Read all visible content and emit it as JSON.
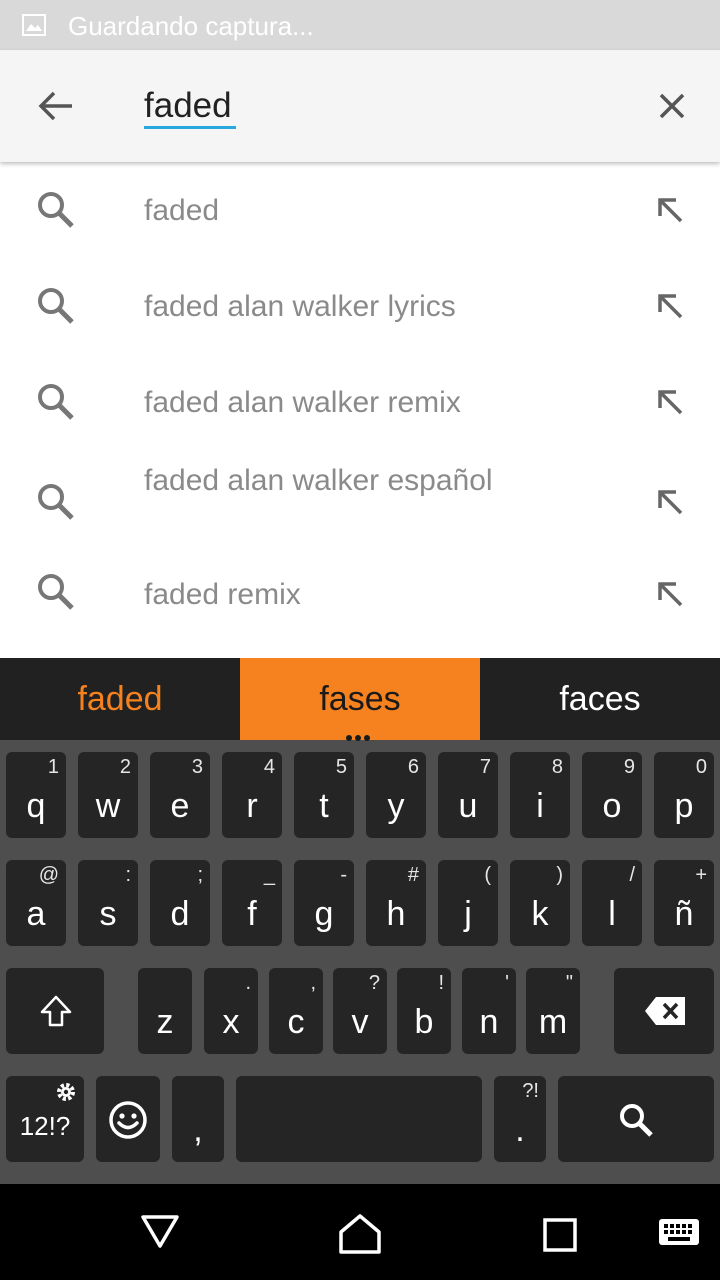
{
  "status_bar": {
    "icon": "image-icon",
    "text": "Guardando captura..."
  },
  "search": {
    "query": "faded",
    "back_icon": "arrow-left-icon",
    "clear_icon": "close-icon"
  },
  "suggestions": [
    {
      "text": "faded",
      "icon": "search-icon",
      "action_icon": "arrow-up-left-icon"
    },
    {
      "text": "faded alan walker lyrics",
      "icon": "search-icon",
      "action_icon": "arrow-up-left-icon"
    },
    {
      "text": "faded alan walker remix",
      "icon": "search-icon",
      "action_icon": "arrow-up-left-icon"
    },
    {
      "text": "faded alan walker español",
      "icon": "search-icon",
      "action_icon": "arrow-up-left-icon"
    },
    {
      "text": "faded remix",
      "icon": "search-icon",
      "action_icon": "arrow-up-left-icon"
    }
  ],
  "keyboard": {
    "accent_color": "#f5821f",
    "candidates": [
      "faded",
      "fases",
      "faces"
    ],
    "selected_candidate": "fases",
    "row1": [
      {
        "main": "q",
        "hint": "1"
      },
      {
        "main": "w",
        "hint": "2"
      },
      {
        "main": "e",
        "hint": "3"
      },
      {
        "main": "r",
        "hint": "4"
      },
      {
        "main": "t",
        "hint": "5"
      },
      {
        "main": "y",
        "hint": "6"
      },
      {
        "main": "u",
        "hint": "7"
      },
      {
        "main": "i",
        "hint": "8"
      },
      {
        "main": "o",
        "hint": "9"
      },
      {
        "main": "p",
        "hint": "0"
      }
    ],
    "row2": [
      {
        "main": "a",
        "hint": "@"
      },
      {
        "main": "s",
        "hint": ":"
      },
      {
        "main": "d",
        "hint": ";"
      },
      {
        "main": "f",
        "hint": "_"
      },
      {
        "main": "g",
        "hint": "-"
      },
      {
        "main": "h",
        "hint": "#"
      },
      {
        "main": "j",
        "hint": "("
      },
      {
        "main": "k",
        "hint": ")"
      },
      {
        "main": "l",
        "hint": "/"
      },
      {
        "main": "ñ",
        "hint": "+"
      }
    ],
    "row3": [
      {
        "main": "z",
        "hint": ""
      },
      {
        "main": "x",
        "hint": "."
      },
      {
        "main": "c",
        "hint": ","
      },
      {
        "main": "v",
        "hint": "?"
      },
      {
        "main": "b",
        "hint": "!"
      },
      {
        "main": "n",
        "hint": "'"
      },
      {
        "main": "m",
        "hint": "\""
      }
    ],
    "shift_icon": "shift-icon",
    "backspace_icon": "backspace-icon",
    "symbols_key": "12!?",
    "settings_icon": "gear-icon",
    "emoji_icon": "emoji-icon",
    "comma_key": ",",
    "period_key": ".",
    "period_hint": "?!",
    "search_icon": "search-icon"
  },
  "nav_bar": {
    "back_icon": "triangle-back-icon",
    "home_icon": "home-icon",
    "recents_icon": "square-recents-icon",
    "keyboard_icon": "keyboard-icon"
  }
}
